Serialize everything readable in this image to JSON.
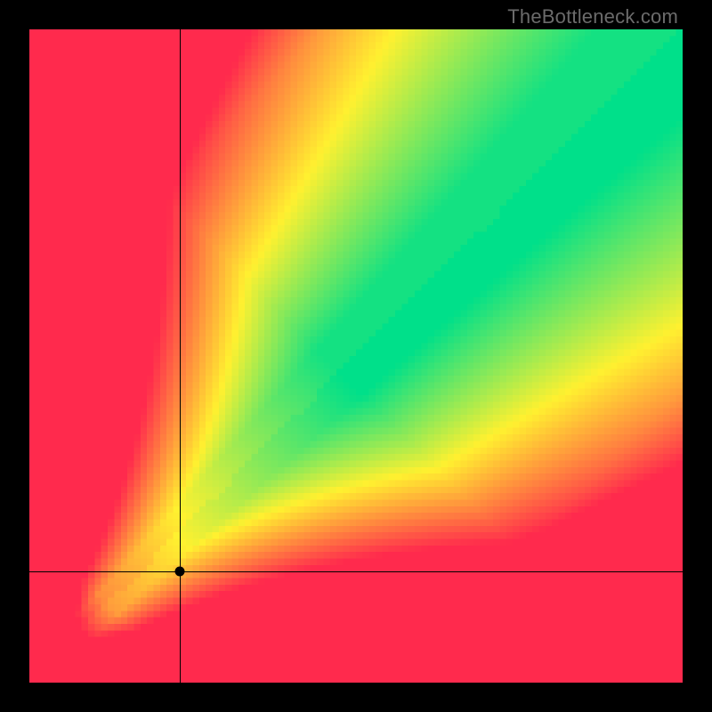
{
  "watermark": "TheBottleneck.com",
  "colors": {
    "red": "#ff2a4d",
    "yellow": "#fff130",
    "green": "#00e08a",
    "frame": "#000000"
  },
  "chart_data": {
    "type": "heatmap",
    "title": "",
    "xlabel": "",
    "ylabel": "",
    "xlim": [
      0,
      100
    ],
    "ylim": [
      0,
      100
    ],
    "marker": {
      "x": 23,
      "y": 17
    },
    "crosshair": {
      "x": 23,
      "y": 17
    },
    "diagonal_band": {
      "center_slope": 1.0,
      "intercept": 0,
      "core_width_fraction_at_top": 0.16,
      "color": "green"
    },
    "value_model": "distance_to_diagonal",
    "grid": false,
    "pixelated": true,
    "grid_resolution": 100
  }
}
